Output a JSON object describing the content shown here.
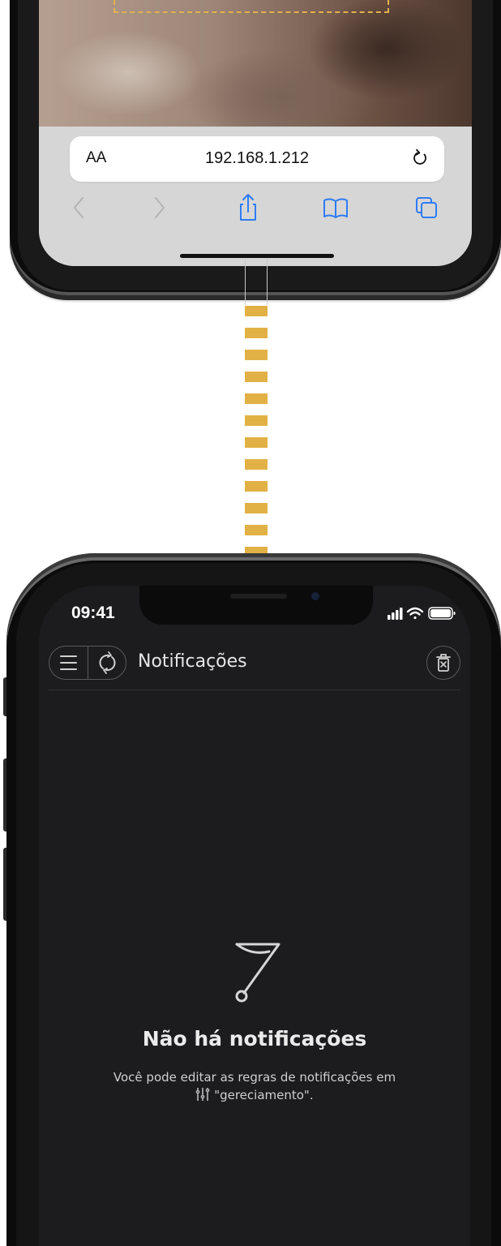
{
  "top_phone": {
    "url_text_size_label": "AA",
    "url": "192.168.1.212",
    "icons": [
      "reload-icon",
      "back-chevron-icon",
      "forward-chevron-icon",
      "share-icon",
      "bookmarks-book-icon",
      "tabs-icon"
    ]
  },
  "connector": {
    "color": "#e2b145"
  },
  "bottom_phone": {
    "status": {
      "time": "09:41",
      "icons": [
        "signal-icon",
        "wifi-icon",
        "battery-icon"
      ]
    },
    "header": {
      "title": "Notificações",
      "left_buttons": [
        "menu-icon",
        "refresh-icon"
      ],
      "right_button": "trash-icon"
    },
    "empty_state": {
      "icon": "flag-icon",
      "title": "Não há notificações",
      "description_before": "Você pode editar as regras de notificações em",
      "description_icon": "sliders-icon",
      "description_after": "\"gereciamento\"."
    }
  }
}
